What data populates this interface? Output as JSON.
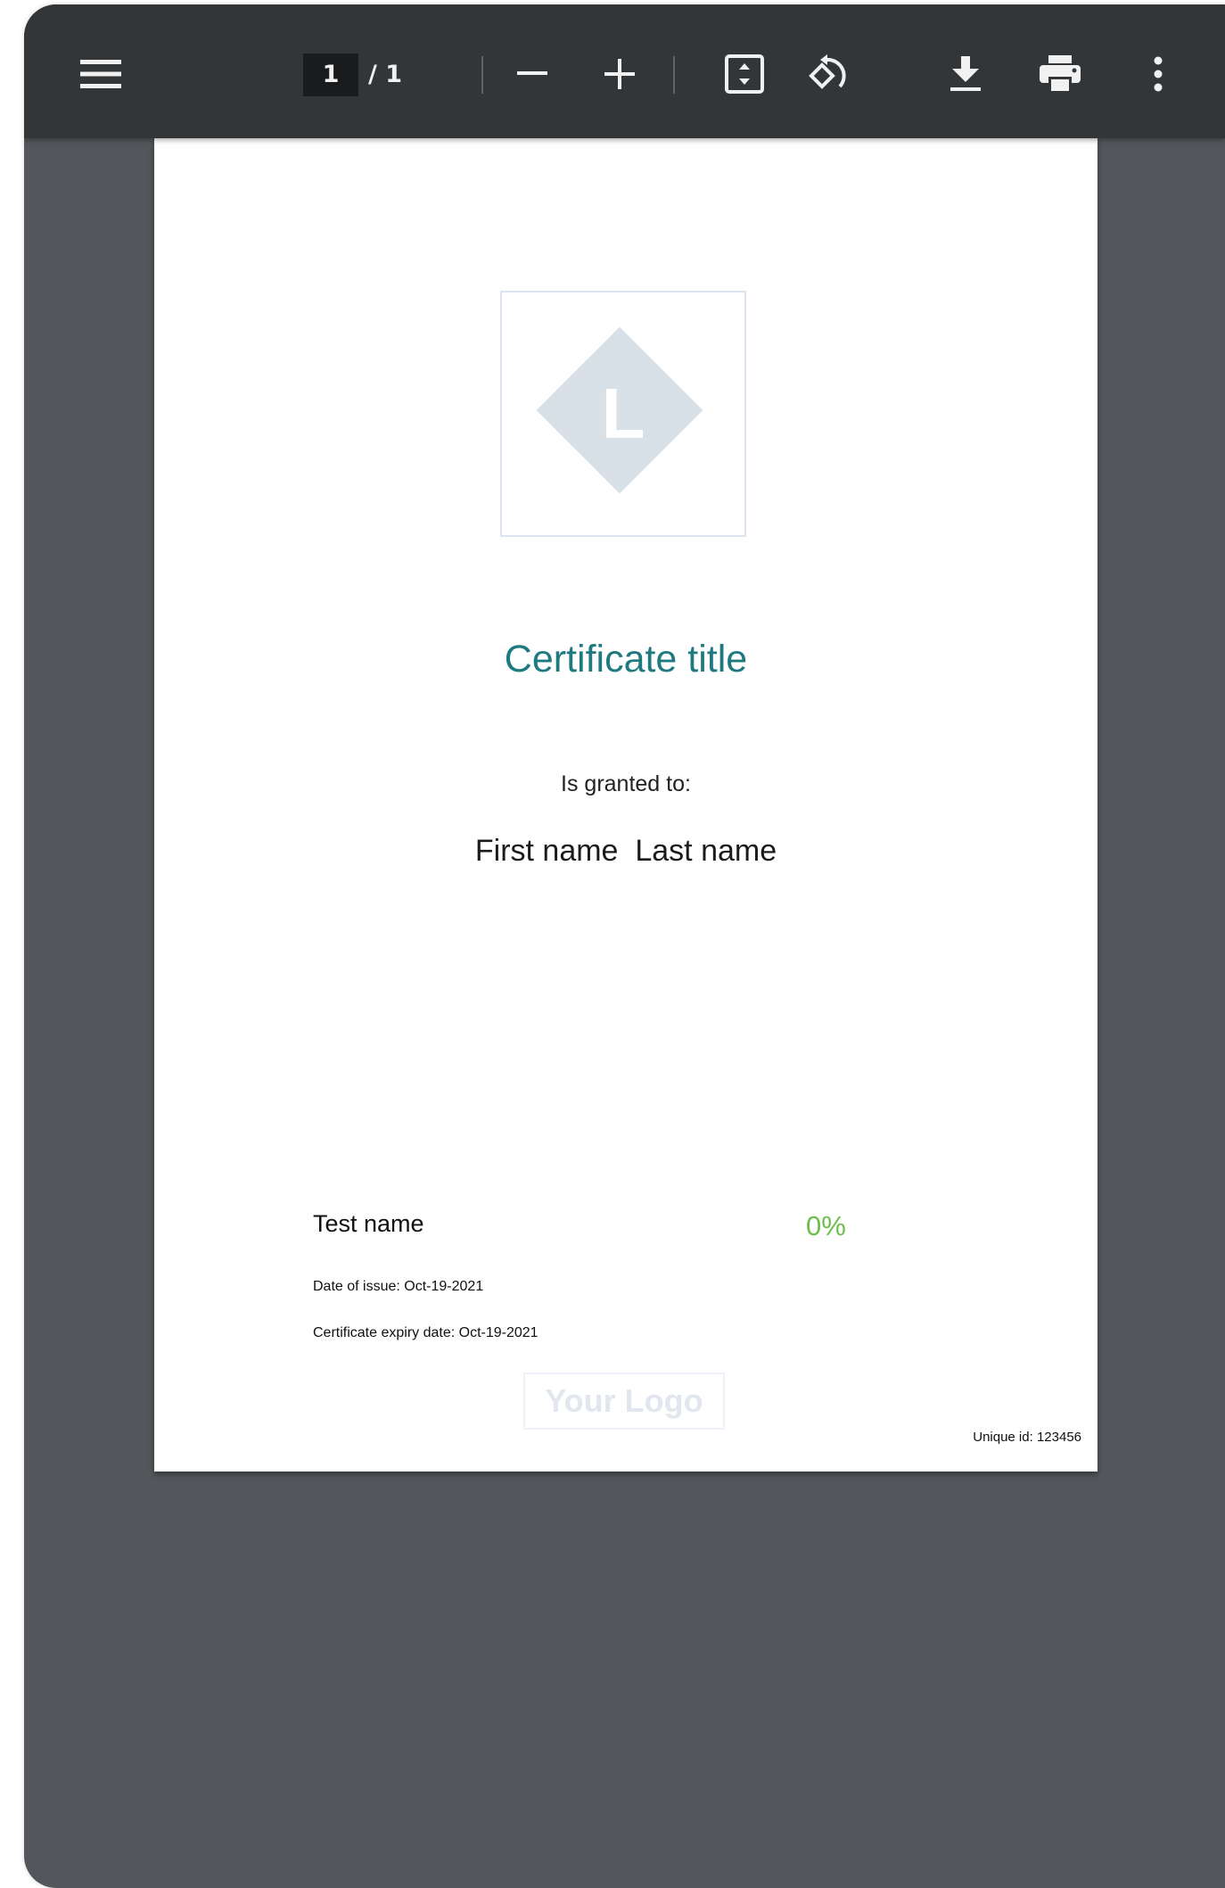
{
  "toolbar": {
    "menu_icon": "hamburger-menu-icon",
    "current_page": "1",
    "page_total": "/ 1",
    "zoom_out_icon": "minus-icon",
    "zoom_in_icon": "plus-icon",
    "fit_icon": "fit-to-page-icon",
    "rotate_icon": "rotate-icon",
    "download_icon": "download-icon",
    "print_icon": "print-icon",
    "more_icon": "more-vertical-icon"
  },
  "certificate": {
    "title": "Certificate title",
    "granted_label": "Is granted to:",
    "recipient": "First name  Last name",
    "test_name": "Test name",
    "score": "0%",
    "date_of_issue": "Date of issue: Oct-19-2021",
    "expiry_date": "Certificate expiry date: Oct-19-2021",
    "footer_logo_text": "Your Logo",
    "unique_id": "Unique id: 123456",
    "header_logo_letter": "L"
  },
  "colors": {
    "toolbar_bg": "#323639",
    "viewer_bg": "#53565a",
    "title_color": "#1f7a80",
    "score_color": "#6cbf4a",
    "logo_diamond": "#d8e1e8"
  }
}
